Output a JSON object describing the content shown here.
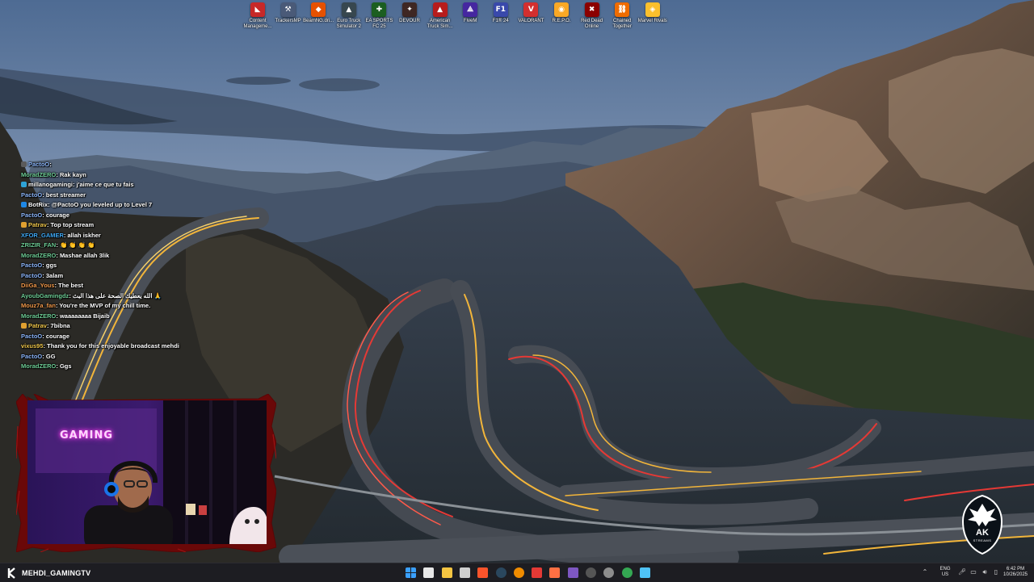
{
  "desktop_icons": [
    {
      "label": "Content Manageme...",
      "icon": "content-manager-icon",
      "color": "#c62828",
      "glyph": "◣"
    },
    {
      "label": "TrackersMP",
      "icon": "trackersmp-icon",
      "color": "#4a5a78",
      "glyph": "⚒"
    },
    {
      "label": "BeamNG.dri...",
      "icon": "beamng-icon",
      "color": "#e65100",
      "glyph": "◆"
    },
    {
      "label": "Euro Truck Simulator 2",
      "icon": "euro-truck-icon",
      "color": "#37474f",
      "glyph": "▲"
    },
    {
      "label": "EA SPORTS FC 25",
      "icon": "ea-fc-icon",
      "color": "#1b5e20",
      "glyph": "✚"
    },
    {
      "label": "DEVOUR",
      "icon": "devour-icon",
      "color": "#3e2723",
      "glyph": "✦"
    },
    {
      "label": "American Truck Sim...",
      "icon": "american-truck-icon",
      "color": "#b71c1c",
      "glyph": "▲"
    },
    {
      "label": "FiveM",
      "icon": "fivem-icon",
      "color": "#4527a0",
      "glyph": "⟁"
    },
    {
      "label": "F1® 24",
      "icon": "f1-24-icon",
      "color": "#3949ab",
      "glyph": "F1"
    },
    {
      "label": "VALORANT",
      "icon": "valorant-icon",
      "color": "#d32f2f",
      "glyph": "V"
    },
    {
      "label": "R.E.P.O.",
      "icon": "repo-icon",
      "color": "#f9a825",
      "glyph": "◉"
    },
    {
      "label": "Red Dead Online",
      "icon": "red-dead-online-icon",
      "color": "#8b0000",
      "glyph": "✖"
    },
    {
      "label": "Chained Together",
      "icon": "chained-together-icon",
      "color": "#ef6c00",
      "glyph": "⛓"
    },
    {
      "label": "Marvel Rivals",
      "icon": "marvel-rivals-icon",
      "color": "#fbc02d",
      "glyph": "◈"
    }
  ],
  "chat_messages": [
    {
      "user": "PactoO",
      "text": "",
      "user_color": "#8ab4f8",
      "badge": "#5b5b5b"
    },
    {
      "user": "MoradZERO",
      "text": "Rak kayn",
      "user_color": "#6fcf97",
      "badge": ""
    },
    {
      "user": "millanogamingi",
      "text": "j'aime ce que tu fais",
      "user_color": "#ffffff",
      "badge": "#2ea3d6"
    },
    {
      "user": "PactoO",
      "text": "best streamer",
      "user_color": "#8ab4f8",
      "badge": ""
    },
    {
      "user": "BotRix",
      "text": "@PactoO you leveled up to Level 7",
      "user_color": "#ffffff",
      "badge": "#1e88e5"
    },
    {
      "user": "PactoO",
      "text": "courage",
      "user_color": "#8ab4f8",
      "badge": ""
    },
    {
      "user": "Patrav",
      "text": "Top top stream",
      "user_color": "#f2c94c",
      "badge": "#e0a030"
    },
    {
      "user": "XFOR_GAMER",
      "text": "allah iskher",
      "user_color": "#3fa9f5",
      "badge": ""
    },
    {
      "user": "ZRIZIR_FAN",
      "text": "👏 👏 👏 👏",
      "user_color": "#6fcf97",
      "badge": ""
    },
    {
      "user": "MoradZERO",
      "text": "Mashae allah 3lik",
      "user_color": "#6fcf97",
      "badge": ""
    },
    {
      "user": "PactoO",
      "text": "ggs",
      "user_color": "#8ab4f8",
      "badge": ""
    },
    {
      "user": "PactoO",
      "text": "3alam",
      "user_color": "#8ab4f8",
      "badge": ""
    },
    {
      "user": "DiiGa_Yous",
      "text": "The best",
      "user_color": "#f2994a",
      "badge": ""
    },
    {
      "user": "AyoubGamingdz",
      "text": "الله يعطيك الصحة على هذا البث 🙏",
      "user_color": "#6fcf97",
      "badge": ""
    },
    {
      "user": "Mouz7a_fan",
      "text": "You're the MVP of my chill time.",
      "user_color": "#f2994a",
      "badge": ""
    },
    {
      "user": "MoradZERO",
      "text": "waaaaaaaa Bijaib",
      "user_color": "#6fcf97",
      "badge": ""
    },
    {
      "user": "Patrav",
      "text": "7bibna",
      "user_color": "#f2c94c",
      "badge": "#e0a030"
    },
    {
      "user": "PactoO",
      "text": "courage",
      "user_color": "#8ab4f8",
      "badge": ""
    },
    {
      "user": "vixus95",
      "text": "Thank you for this enjoyable broadcast mehdi",
      "user_color": "#f2c94c",
      "badge": ""
    },
    {
      "user": "PactoO",
      "text": "GG",
      "user_color": "#8ab4f8",
      "badge": ""
    },
    {
      "user": "MoradZERO",
      "text": "Ggs",
      "user_color": "#6fcf97",
      "badge": ""
    }
  ],
  "webcam": {
    "neon_sign": "GAMING"
  },
  "logo": {
    "text": "AK",
    "subtitle": "STREAMS"
  },
  "taskbar": {
    "channel_name": "MEHDI_GAMINGTV",
    "apps": [
      {
        "icon": "windows-start-icon",
        "color": "#3aa0ff"
      },
      {
        "icon": "calendar-icon",
        "color": "#e8e8e8"
      },
      {
        "icon": "file-explorer-icon",
        "color": "#f5c542"
      },
      {
        "icon": "task-view-icon",
        "color": "#cfcfcf"
      },
      {
        "icon": "brave-browser-icon",
        "color": "#fb542b"
      },
      {
        "icon": "steam-icon",
        "color": "#2a475e"
      },
      {
        "icon": "vlc-icon",
        "color": "#f08c00"
      },
      {
        "icon": "app-red-icon",
        "color": "#e53935"
      },
      {
        "icon": "app-orange-icon",
        "color": "#ff7043"
      },
      {
        "icon": "app-purple-icon",
        "color": "#7e57c2"
      },
      {
        "icon": "obs-icon",
        "color": "#555555"
      },
      {
        "icon": "app-circle-icon",
        "color": "#8d8d8d"
      },
      {
        "icon": "chrome-icon",
        "color": "#34a853"
      },
      {
        "icon": "notepad-icon",
        "color": "#4fc3f7"
      }
    ],
    "language_top": "ENG",
    "language_bottom": "US",
    "time": "6:42 PM",
    "date": "10/26/2025"
  }
}
